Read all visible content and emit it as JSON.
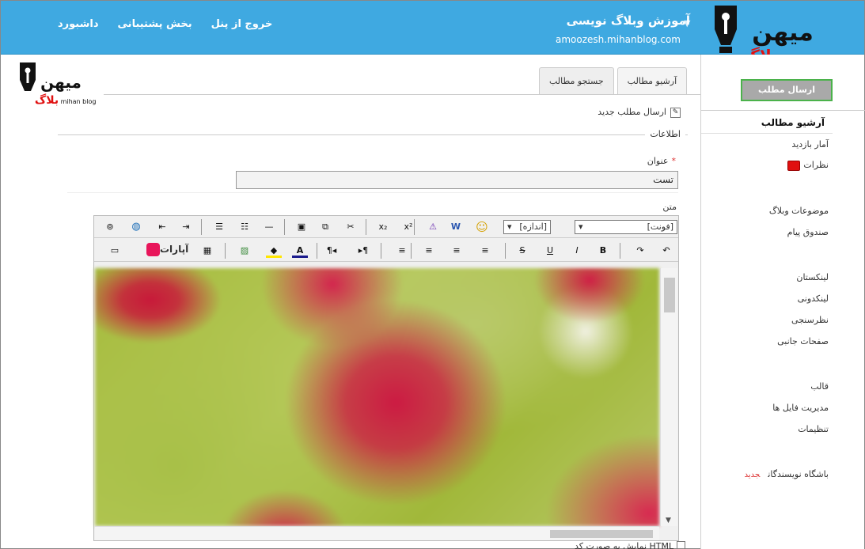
{
  "header": {
    "links": [
      "خروج از پنل",
      "بخش پشتیبانی",
      "داشبورد"
    ],
    "blog_title": "آموزش وبلاگ نویسی",
    "blog_url": "amoozesh.mihanblog.com",
    "logo_text": "میهن بلاگ",
    "logo_sub": "mihan blog",
    "bg_color": "#3fa9e1"
  },
  "sidebar": {
    "send_button": "ارسال مطلب",
    "section_head": "آرشیو مطالب",
    "items": [
      "آمار بازدید",
      "نظرات",
      "موضوعات وبلاگ",
      "صندوق پیام",
      "لینکستان",
      "لینکدونی",
      "نظرسنجی",
      "صفحات جانبی",
      "قالب",
      "مدیریت فایل ها",
      "تنظیمات",
      "باشگاه نویسندگان"
    ],
    "new_badge": "جدید"
  },
  "tabs": [
    "جستجو مطالب",
    "آرشیو مطالب"
  ],
  "form": {
    "new_post_label": "ارسال مطلب جدید",
    "legend": "اطلاعات",
    "title_label": "عنوان",
    "title_value": "تست",
    "text_label": "متن",
    "html_mode_label": "نمایش به صورت کد HTML"
  },
  "editor": {
    "font_select": "[فونت]",
    "size_select": "[اندازه]",
    "aparat_label": "آپارات",
    "row1_icons": [
      "link-icon",
      "web-link-icon",
      "indent-icon",
      "outdent-icon",
      "bullet-list-icon",
      "numbered-list-icon",
      "horizontal-rule-icon",
      "paste-icon",
      "copy-icon",
      "cut-icon",
      "subscript-icon",
      "superscript-icon",
      "remove-format-icon",
      "paste-word-icon",
      "emoticon-icon"
    ],
    "row2_icons": [
      "video-icon",
      "table-icon",
      "image-icon",
      "highlight-color-icon",
      "font-color-icon",
      "rtl-icon",
      "ltr-icon",
      "justify-icon",
      "align-left-icon",
      "align-center-icon",
      "align-right-icon",
      "strike-icon",
      "underline-icon",
      "italic-icon",
      "bold-icon",
      "redo-icon",
      "undo-icon"
    ],
    "row1_glyphs": [
      "⊚",
      "◍",
      "⇤",
      "⇥",
      "☰",
      "☷",
      "—",
      "▣",
      "⧉",
      "✂",
      "x₂",
      "x²",
      "⚠",
      "W",
      "☺"
    ],
    "row2_glyphs": [
      "▭",
      "▦",
      "▨",
      "◆",
      "A",
      "¶◂",
      "▸¶",
      "≡",
      "≡",
      "≡",
      "≡",
      "S",
      "U",
      "I",
      "B",
      "↷",
      "↶"
    ]
  }
}
